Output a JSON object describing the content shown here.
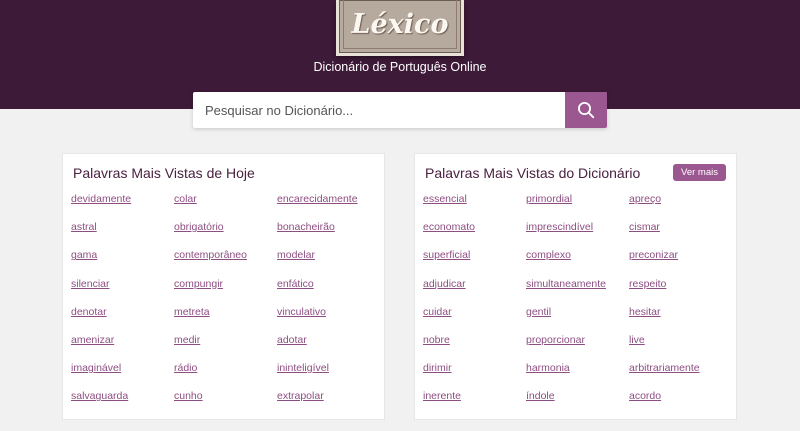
{
  "header": {
    "logo_text": "Léxico",
    "tagline": "Dicionário de Português Online",
    "search_placeholder": "Pesquisar no Dicionário..."
  },
  "today": {
    "title": "Palavras Mais Vistas de Hoje",
    "words": [
      "devidamente",
      "colar",
      "encarecidamente",
      "astral",
      "obrigatório",
      "bonacheirão",
      "gama",
      "contemporâneo",
      "modelar",
      "silenciar",
      "compungir",
      "enfático",
      "denotar",
      "metreta",
      "vinculativo",
      "amenizar",
      "medir",
      "adotar",
      "imaginável",
      "rádio",
      "ininteligível",
      "salvaguarda",
      "cunho",
      "extrapolar"
    ]
  },
  "dictionary": {
    "title": "Palavras Mais Vistas do Dicionário",
    "more_label": "Ver mais",
    "words": [
      "essencial",
      "primordial",
      "apreço",
      "economato",
      "imprescindível",
      "cismar",
      "superficial",
      "complexo",
      "preconizar",
      "adjudicar",
      "simultaneamente",
      "respeito",
      "cuidar",
      "gentil",
      "hesitar",
      "nobre",
      "proporcionar",
      "live",
      "dirimir",
      "harmonia",
      "arbitrariamente",
      "inerente",
      "índole",
      "acordo"
    ]
  },
  "colors": {
    "header_bg": "#3d1a37",
    "accent": "#9b578f",
    "link": "#8d4e82"
  },
  "icons": {
    "search": "search-icon"
  }
}
